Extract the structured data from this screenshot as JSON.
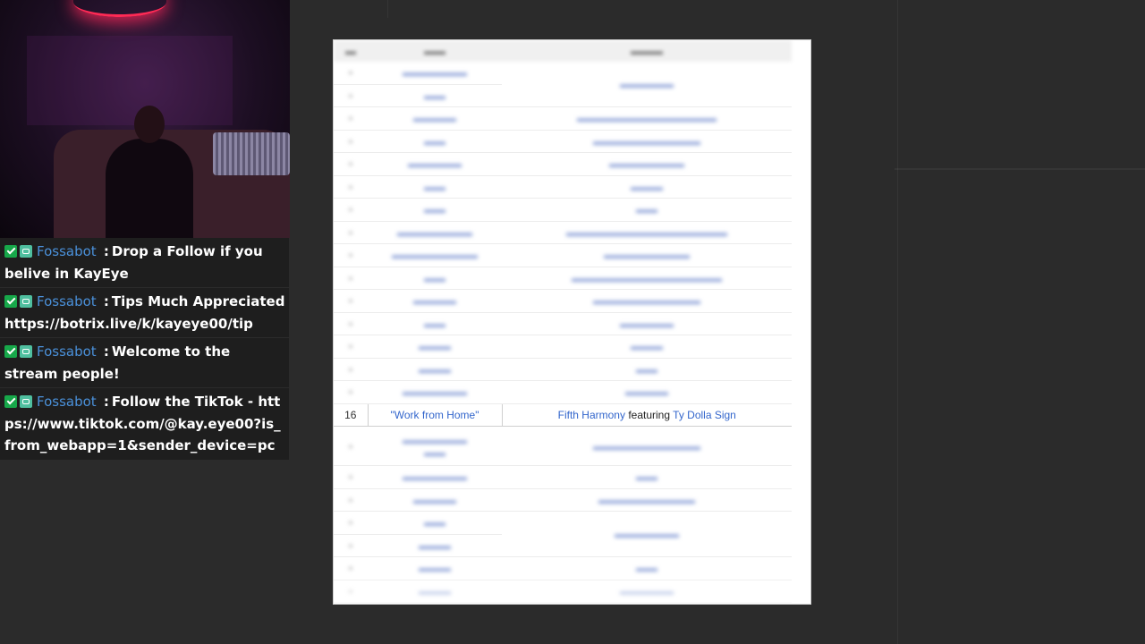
{
  "chat": {
    "messages": [
      {
        "user": "Fossabot",
        "text": "Drop a Follow if you belive in KayEye"
      },
      {
        "user": "Fossabot",
        "text": "Tips Much Appreciated https://botrix.live/k/kayeye00/tip"
      },
      {
        "user": "Fossabot",
        "text": "Welcome to the stream people!"
      },
      {
        "user": "Fossabot",
        "text": "Follow the TikTok - https://www.tiktok.com/@kay.eye00?is_from_webapp=1&sender_device=pc"
      }
    ],
    "separator": ":"
  },
  "table": {
    "highlighted_row": {
      "no": "16",
      "title": "\"Work from Home\"",
      "artist": "Fifth Harmony",
      "featuring_word": "featuring",
      "featured_artist": "Ty Dolla Sign"
    }
  },
  "colors": {
    "link": "#3366cc",
    "chat_username": "#4a90d9",
    "chat_background": "#1e1e1e",
    "page_background": "#2b2b2b",
    "moderator_badge": "#17a84a"
  },
  "icons": [
    "moderator-badge-icon",
    "bot-badge-icon"
  ]
}
